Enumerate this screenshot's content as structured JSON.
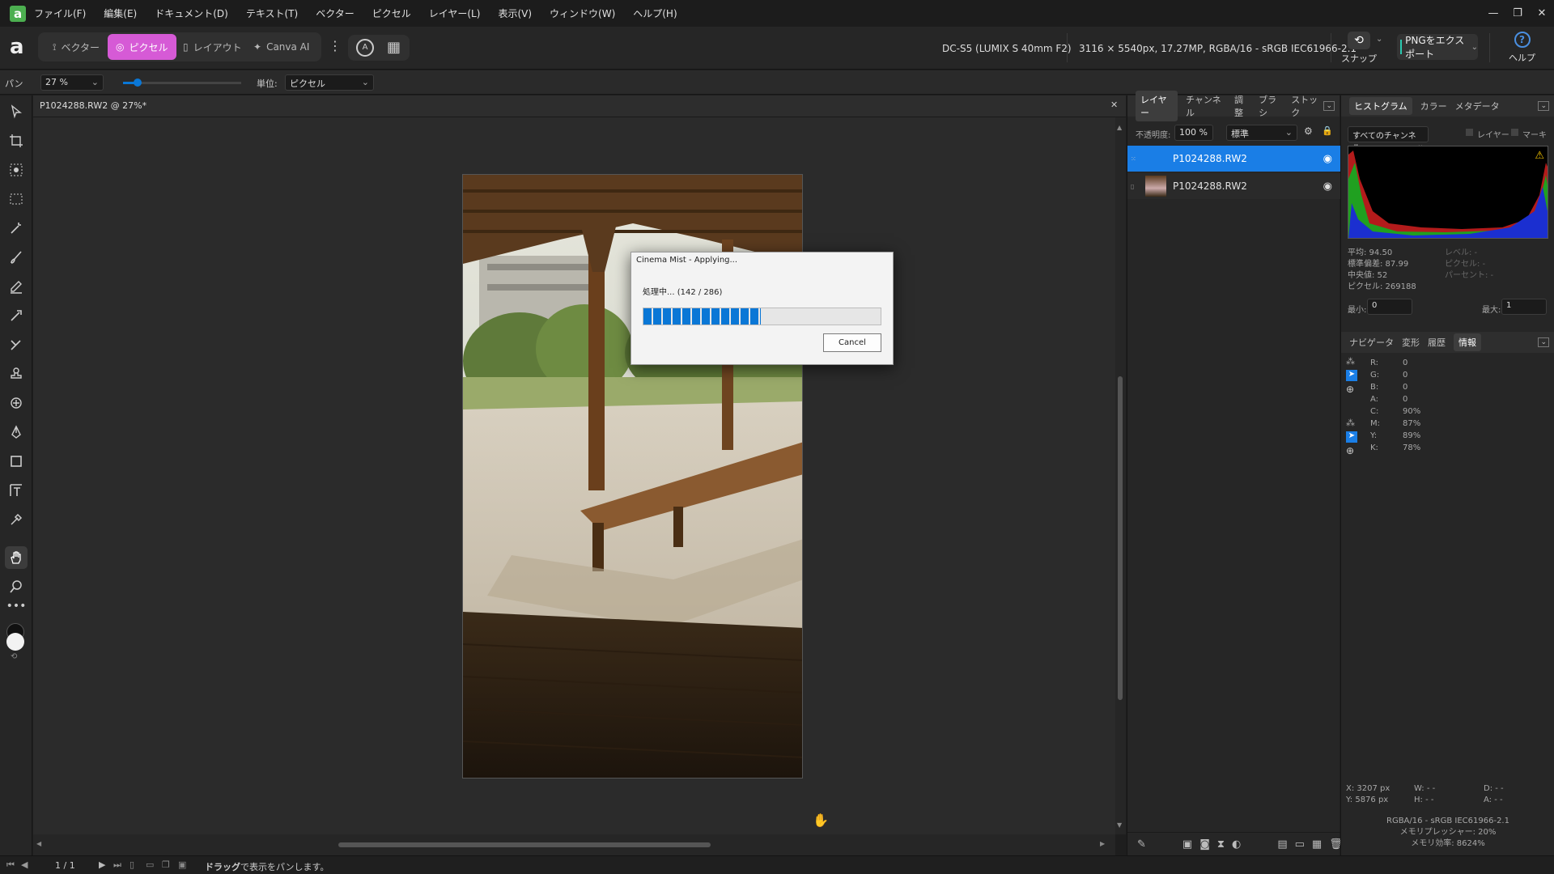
{
  "menu": [
    "ファイル(F)",
    "編集(E)",
    "ドキュメント(D)",
    "テキスト(T)",
    "ベクター",
    "ピクセル",
    "レイヤー(L)",
    "表示(V)",
    "ウィンドウ(W)",
    "ヘルプ(H)"
  ],
  "window_controls": {
    "minimize": "—",
    "restore": "❐",
    "close": "✕"
  },
  "personas": {
    "vector": "ベクター",
    "pixel": "ピクセル",
    "layout": "レイアウト",
    "canva": "Canva AI"
  },
  "toolbar_info": {
    "camera": "DC-S5 (LUMIX S 40mm F2)",
    "image_info": "3116 × 5540px, 17.27MP, RGBA/16 - sRGB IEC61966-2.1",
    "snap_label": "スナップ",
    "export_label": "PNGをエクスポート",
    "help_label": "ヘルプ"
  },
  "context": {
    "tool_label": "パン",
    "zoom_value": "27 %",
    "unit_label": "単位:",
    "unit_value": "ピクセル"
  },
  "document": {
    "tab_title": "P1024288.RW2 @ 27%*",
    "close": "✕"
  },
  "dialog": {
    "title": "Cinema Mist - Applying...",
    "status": "処理中... (142 / 286)",
    "progress": 0.4965,
    "cancel": "Cancel"
  },
  "layers_panel": {
    "tabs": [
      "レイヤー",
      "チャンネル",
      "調整",
      "ブラシ",
      "ストック"
    ],
    "opacity_label": "不透明度:",
    "opacity_value": "100 %",
    "blend_value": "標準",
    "layers": [
      {
        "name": "P1024288.RW2",
        "selected": true
      },
      {
        "name": "P1024288.RW2",
        "selected": false
      }
    ]
  },
  "histogram_panel": {
    "tabs": [
      "ヒストグラム",
      "カラー",
      "メタデータ"
    ],
    "channel": "すべてのチャンネル",
    "layer_label": "レイヤー",
    "marquee_label": "マーキー",
    "stats": {
      "mean": "平均: 94.50",
      "stddev": "標準偏差: 87.99",
      "median": "中央値: 52",
      "pixels": "ピクセル: 269188"
    },
    "stats_right": {
      "level": "レベル: -",
      "pixel": "ピクセル: -",
      "percent": "パーセント: -"
    },
    "min_label": "最小:",
    "min_value": "0",
    "max_label": "最大:",
    "max_value": "1"
  },
  "info_panel": {
    "tabs": [
      "ナビゲータ",
      "変形",
      "履歴",
      "情報"
    ],
    "rgba": [
      {
        "k": "R:",
        "v": "0"
      },
      {
        "k": "G:",
        "v": "0"
      },
      {
        "k": "B:",
        "v": "0"
      },
      {
        "k": "A:",
        "v": "0"
      }
    ],
    "cmyk": [
      {
        "k": "C:",
        "v": "90%"
      },
      {
        "k": "M:",
        "v": "87%"
      },
      {
        "k": "Y:",
        "v": "89%"
      },
      {
        "k": "K:",
        "v": "78%"
      }
    ],
    "x": "X: 3207 px",
    "y": "Y: 5876 px",
    "w": "W: - -",
    "h": "H: - -",
    "d": "D: - -",
    "a": "A: - -",
    "color_profile": "RGBA/16 - sRGB IEC61966-2.1",
    "memory_pressure": "メモリプレッシャー: 20%",
    "memory_eff": "メモリ効率: 8624%"
  },
  "statusbar": {
    "page": "1 / 1",
    "hint_bold": "ドラッグ",
    "hint": "で表示をパンします。"
  },
  "colors": {
    "accent": "#0a77d6",
    "persona_active": "#d65ad6",
    "selected_layer": "#1a7ee6"
  }
}
